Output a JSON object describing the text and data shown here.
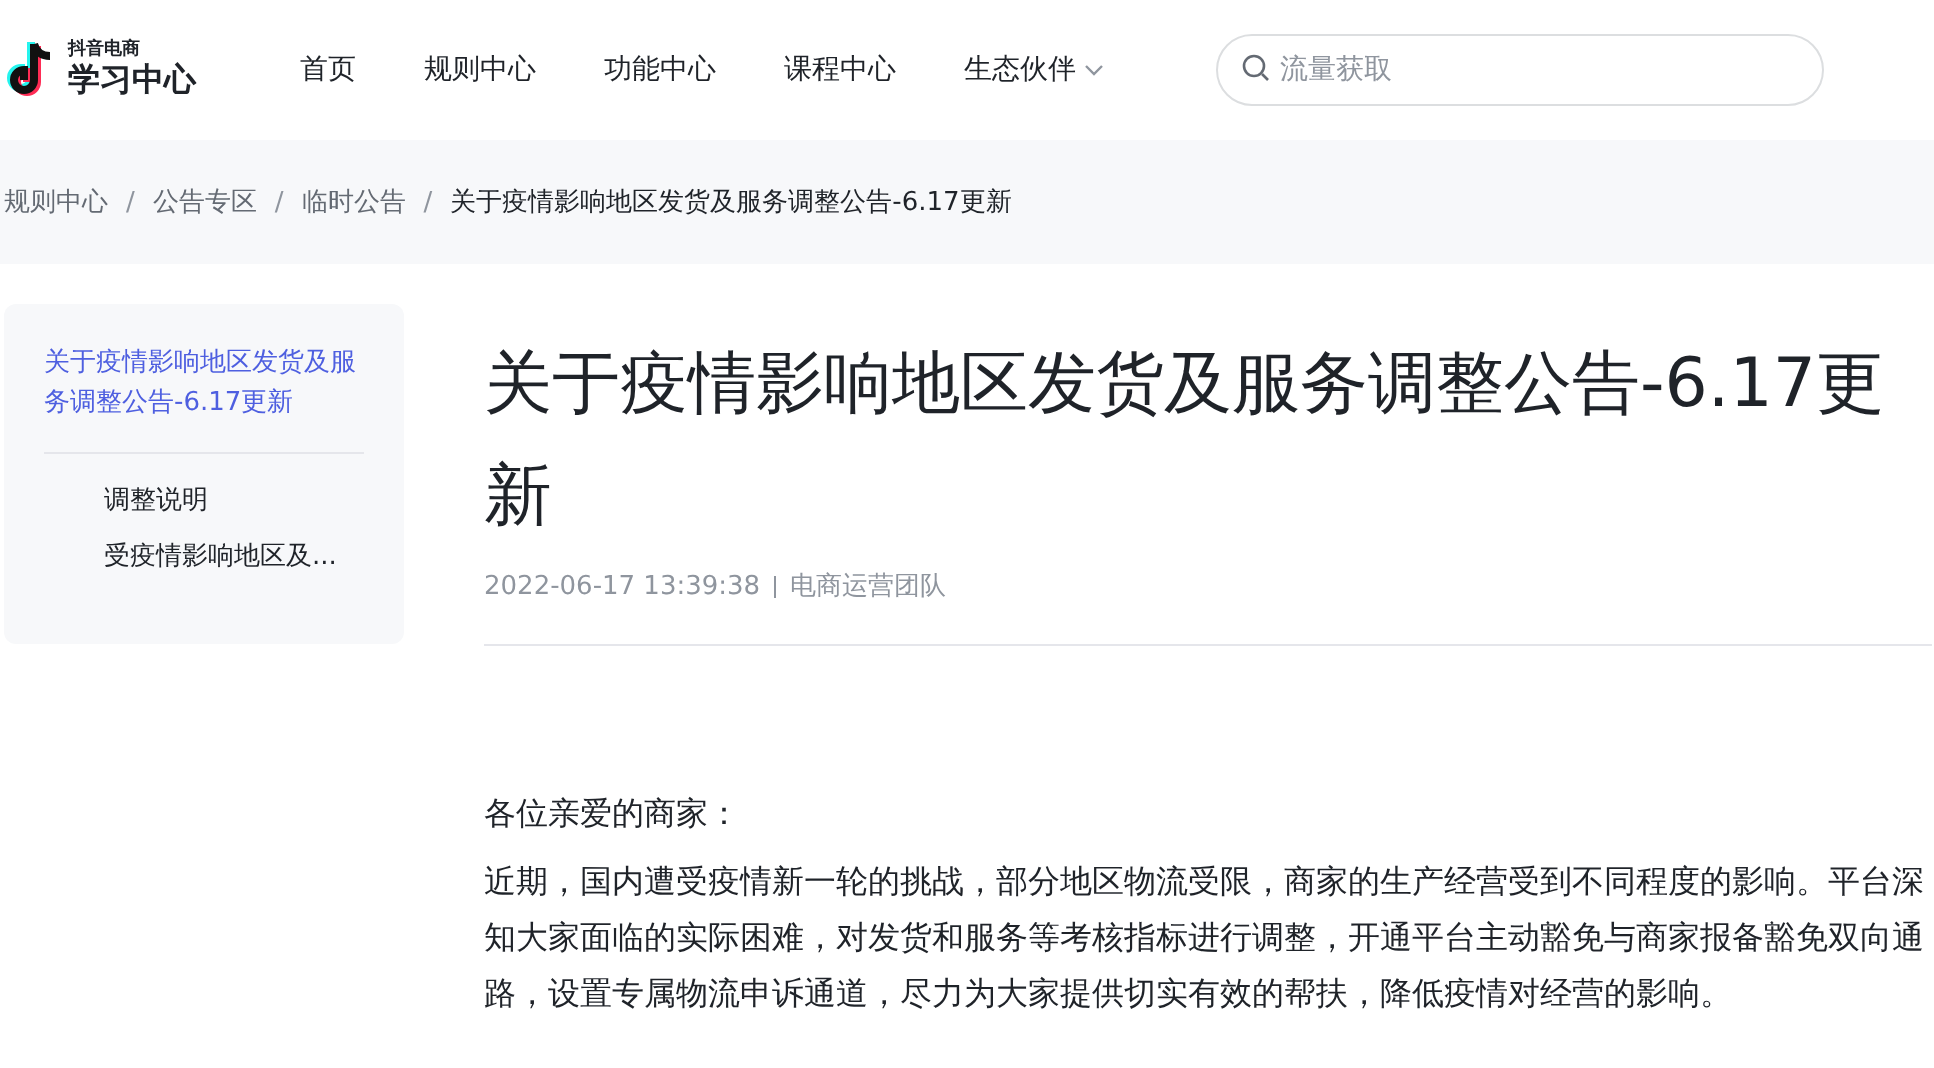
{
  "header": {
    "logo_small": "抖音电商",
    "logo_title": "学习中心",
    "nav": [
      {
        "label": "首页",
        "dropdown": false
      },
      {
        "label": "规则中心",
        "dropdown": false
      },
      {
        "label": "功能中心",
        "dropdown": false
      },
      {
        "label": "课程中心",
        "dropdown": false
      },
      {
        "label": "生态伙伴",
        "dropdown": true
      }
    ],
    "search": {
      "placeholder": "流量获取"
    }
  },
  "breadcrumb": {
    "separator": "/",
    "items": [
      "规则中心",
      "公告专区",
      "临时公告",
      "关于疫情影响地区发货及服务调整公告-6.17更新"
    ]
  },
  "toc": [
    {
      "label": "关于疫情影响地区发货及服务调整公告-6.17更新",
      "selected": true,
      "children": [
        {
          "label": "调整说明",
          "selected": false
        },
        {
          "label": "受疫情影响地区及...",
          "selected": false
        }
      ]
    }
  ],
  "article": {
    "title": "关于疫情影响地区发货及服务调整公告-6.17更新",
    "date": "2022-06-17 13:39:38",
    "author": "电商运营团队",
    "paragraphs": [
      "各位亲爱的商家：",
      "近期，国内遭受疫情新一轮的挑战，部分地区物流受限，商家的生产经营受到不同程度的影响。平台深知大家面临的实际困难，对发货和服务等考核指标进行调整，开通平台主动豁免与商家报备豁免双向通路，设置专属物流申诉通道，尽力为大家提供切实有效的帮扶，降低疫情对经营的影响。"
    ]
  }
}
